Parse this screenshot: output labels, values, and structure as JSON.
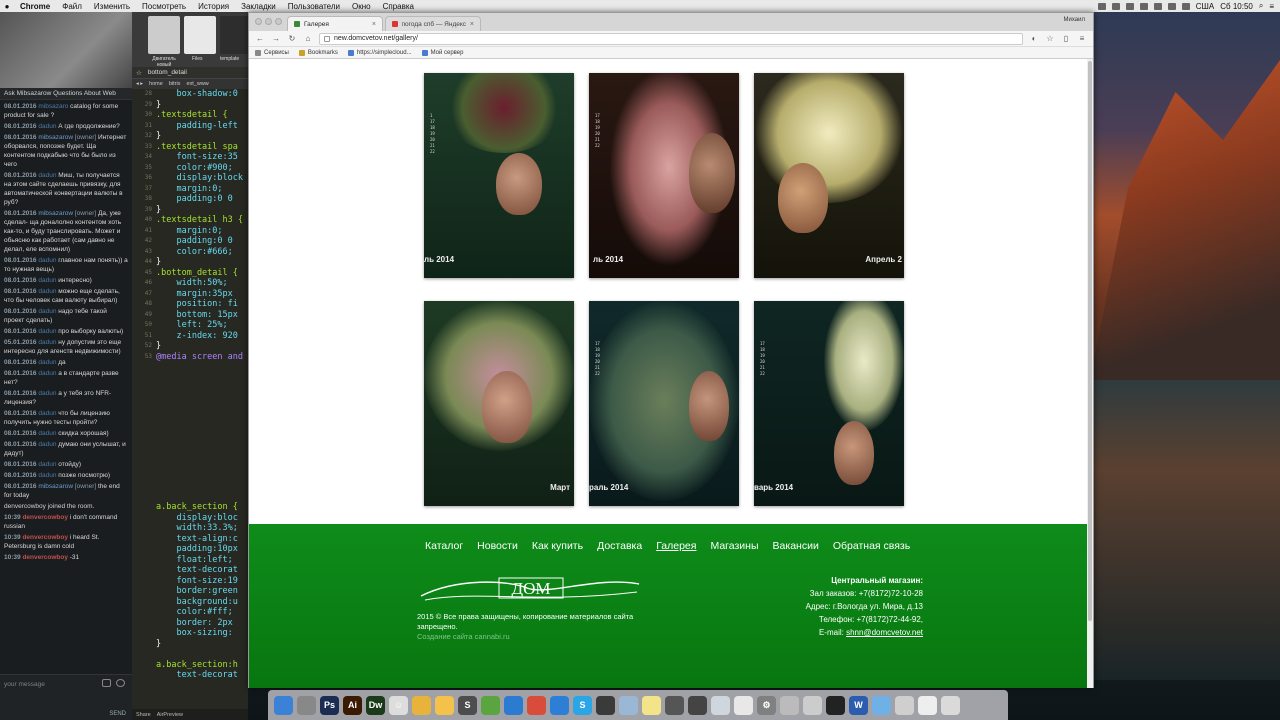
{
  "menubar": {
    "app": "Chrome",
    "items": [
      "Файл",
      "Изменить",
      "Посмотреть",
      "История",
      "Закладки",
      "Пользователи",
      "Окно",
      "Справка"
    ],
    "status_right": "США",
    "clock": "Сб 10:50"
  },
  "chat": {
    "title": "Ask Mibsazarow Questions About Web",
    "messages": [
      {
        "time": "08.01.2016",
        "user": "mibsazaro",
        "text": "catalog for some product for sale ?",
        "kind": "user"
      },
      {
        "time": "08.01.2016",
        "user": "dadun",
        "text": "А где продолжение?",
        "kind": "user"
      },
      {
        "time": "08.01.2016",
        "user": "mibsazarow",
        "tag": "[owner]",
        "text": "Интернет оборвался, попозже будет. Ща контентом подкабыю что бы было из чего",
        "kind": "owner"
      },
      {
        "time": "08.01.2016",
        "user": "dadun",
        "text": "Миш, ты получается на этом сайте сделаешь привязку, для автоматической конвертации валюты в руб?",
        "kind": "user"
      },
      {
        "time": "08.01.2016",
        "user": "mibsazarow",
        "tag": "[owner]",
        "text": "Да, уже сделал- ща доналолно контентом хоть как-то, и буду транслировать. Может и обьясню как работает (сам давно не делал, еле вспомнил)",
        "kind": "owner"
      },
      {
        "time": "08.01.2016",
        "user": "dadun",
        "text": "главное нам понять)) а то нужная вещь)",
        "kind": "user"
      },
      {
        "time": "08.01.2016",
        "user": "dadun",
        "text": "интересно)",
        "kind": "user"
      },
      {
        "time": "08.01.2016",
        "user": "dadun",
        "text": "можно еще сделать, что бы человек сам валюту выбирал)",
        "kind": "user"
      },
      {
        "time": "08.01.2016",
        "user": "dadun",
        "text": "надо тебе такой проект сделать)",
        "kind": "user"
      },
      {
        "time": "08.01.2016",
        "user": "dadun",
        "text": "про выборку валюты)",
        "kind": "user"
      },
      {
        "time": "05.01.2016",
        "user": "dadun",
        "text": "ну допустим это еще интересно для агенств недвижимости)",
        "kind": "user"
      },
      {
        "time": "08.01.2016",
        "user": "dadun",
        "text": "да",
        "kind": "user"
      },
      {
        "time": "08.01.2016",
        "user": "dadun",
        "text": "а в стандарте разве нет?",
        "kind": "user"
      },
      {
        "time": "08.01.2016",
        "user": "dadun",
        "text": "а у тебя это NFR-лицензия?",
        "kind": "user"
      },
      {
        "time": "08.01.2016",
        "user": "dadun",
        "text": "что бы лицензию получить нужно тесты пройти?",
        "kind": "user"
      },
      {
        "time": "08.01.2016",
        "user": "dadun",
        "text": "скидка хорошая)",
        "kind": "user"
      },
      {
        "time": "08.01.2016",
        "user": "dadun",
        "text": "думаю они услышат, и дадут)",
        "kind": "user"
      },
      {
        "time": "08.01.2016",
        "user": "dadun",
        "text": "отойду)",
        "kind": "user"
      },
      {
        "time": "08.01.2016",
        "user": "dadun",
        "text": "позже посмотрю)",
        "kind": "user"
      },
      {
        "time": "08.01.2016",
        "user": "mibsazarow",
        "tag": "[owner]",
        "text": "the end for today",
        "kind": "owner"
      },
      {
        "time": "",
        "user": "",
        "text": "denvercowboy joined the room.",
        "kind": "sys"
      },
      {
        "time": "10:39",
        "user": "denvercowboy",
        "text": "i don't command russian",
        "kind": "red"
      },
      {
        "time": "10:39",
        "user": "denvercowboy",
        "text": "i heard St. Petersburg is damn cold",
        "kind": "red"
      },
      {
        "time": "10:39",
        "user": "denvercowboy",
        "text": "-31",
        "kind": "red"
      }
    ],
    "input_placeholder": "your message",
    "send_label": "SEND"
  },
  "editor": {
    "tiles": [
      "Двигатель новый",
      "Files",
      "template"
    ],
    "filename": "bottom_detail",
    "crumbs": [
      "home",
      "bitrix",
      "ext_www"
    ],
    "line_numbers": [
      "28",
      "29",
      "30",
      "31",
      "32",
      "33",
      "34",
      "35",
      "36",
      "37",
      "38",
      "39",
      "40",
      "41",
      "42",
      "43",
      "44",
      "45",
      "46",
      "47",
      "48",
      "49",
      "50",
      "51",
      "52",
      "53"
    ],
    "lines": [
      "    box-shadow:0",
      "}",
      ".textsdetail {",
      "    padding-left",
      "}",
      ".textsdetail spa",
      "    font-size:35",
      "    color:#900;",
      "    display:block",
      "    margin:0;",
      "    padding:0 0",
      "}",
      ".textsdetail h3 {",
      "    margin:0;",
      "    padding:0 0",
      "    color:#666;",
      "}",
      ".bottom_detail {",
      "    width:50%;",
      "    margin:35px",
      "    position: fi",
      "    bottom: 15px",
      "    left: 25%;",
      "    z-index: 920",
      "}",
      "@media screen and"
    ],
    "lines2": [
      "a.back_section {",
      "    display:bloc",
      "    width:33.3%;",
      "    text-align:c",
      "    padding:10px",
      "    float:left;",
      "    text-decorat",
      "    font-size:19",
      "    border:green",
      "    background:u",
      "    color:#fff;",
      "    border: 2px",
      "    box-sizing:",
      "}",
      "",
      "a.back_section:h",
      "    text-decorat"
    ],
    "status": [
      "Share",
      "AirPreview"
    ]
  },
  "browser": {
    "tabs": [
      {
        "label": "Галерея",
        "active": true
      },
      {
        "label": "погода спб — Яндекс: на",
        "active": false
      }
    ],
    "profile": "Михаил",
    "url": "new.domcvetov.net/gallery/",
    "bookmarks": [
      "Сервисы",
      "Bookmarks",
      "https://simplecloud...",
      "Мой сервер"
    ]
  },
  "gallery": {
    "captions": [
      "ль 2014",
      "ль 2014",
      "Апрель 2",
      "Март",
      "раль 2014",
      "варь 2014"
    ]
  },
  "footer": {
    "nav": [
      {
        "label": "Каталог",
        "active": false
      },
      {
        "label": "Новости",
        "active": false
      },
      {
        "label": "Как купить",
        "active": false
      },
      {
        "label": "Доставка",
        "active": false
      },
      {
        "label": "Галерея",
        "active": true
      },
      {
        "label": "Магазины",
        "active": false
      },
      {
        "label": "Вакансии",
        "active": false
      },
      {
        "label": "Обратная связь",
        "active": false
      }
    ],
    "logo_text": "ДОМ",
    "copyright": "2015 © Все права защищены, копирование материалов сайта запрещено.",
    "credit": "Создание сайта cannabi.ru",
    "contacts": {
      "heading": "Центральный магазин:",
      "line1": "Зал заказов: +7(8172)72-10-28",
      "line2": "Адрес: г.Вологда ул. Мира, д.13",
      "line3": "Телефон: +7(8172)72-44-92,",
      "email_label": "E-mail: ",
      "email": "shnn@domcvetov.net"
    }
  },
  "dock": {
    "icons": [
      {
        "name": "finder-icon",
        "color": "#3b82d6",
        "glyph": ""
      },
      {
        "name": "launchpad-icon",
        "color": "#888888",
        "glyph": ""
      },
      {
        "name": "photoshop-icon",
        "color": "#1b2b52",
        "glyph": "Ps"
      },
      {
        "name": "illustrator-icon",
        "color": "#3a1a00",
        "glyph": "Ai"
      },
      {
        "name": "dreamweaver-icon",
        "color": "#1b3a1a",
        "glyph": "Dw"
      },
      {
        "name": "emoji-icon",
        "color": "#dddddd",
        "glyph": "☺"
      },
      {
        "name": "chrome-canary-icon",
        "color": "#e8b33b",
        "glyph": ""
      },
      {
        "name": "sketch-icon",
        "color": "#f4c24b",
        "glyph": ""
      },
      {
        "name": "sublime-icon",
        "color": "#4d4d4d",
        "glyph": "S"
      },
      {
        "name": "leaf-icon",
        "color": "#5aa53f",
        "glyph": ""
      },
      {
        "name": "safari-icon",
        "color": "#2b7bd1",
        "glyph": ""
      },
      {
        "name": "chrome-icon",
        "color": "#d94b3b",
        "glyph": ""
      },
      {
        "name": "appstore-icon",
        "color": "#2d7fd6",
        "glyph": ""
      },
      {
        "name": "skype-icon",
        "color": "#2aa5e6",
        "glyph": "S"
      },
      {
        "name": "obs-icon",
        "color": "#3a3a3a",
        "glyph": ""
      },
      {
        "name": "preview-icon",
        "color": "#9bb7d6",
        "glyph": ""
      },
      {
        "name": "notes-icon",
        "color": "#f3e48a",
        "glyph": ""
      },
      {
        "name": "camera-icon",
        "color": "#555555",
        "glyph": ""
      },
      {
        "name": "capture-icon",
        "color": "#444444",
        "glyph": ""
      },
      {
        "name": "cubes-icon",
        "color": "#cfd6dd",
        "glyph": ""
      },
      {
        "name": "textedit-icon",
        "color": "#e8e8e8",
        "glyph": ""
      },
      {
        "name": "settings-icon",
        "color": "#808080",
        "glyph": "⚙"
      },
      {
        "name": "tools-icon",
        "color": "#bbbbbb",
        "glyph": ""
      },
      {
        "name": "disk-icon",
        "color": "#cccccc",
        "glyph": ""
      },
      {
        "name": "terminal-icon",
        "color": "#222222",
        "glyph": ""
      },
      {
        "name": "word-icon",
        "color": "#2b5cb0",
        "glyph": "W"
      },
      {
        "name": "folder-icon",
        "color": "#6fb0e6",
        "glyph": ""
      },
      {
        "name": "downloads-icon",
        "color": "#cfcfcf",
        "glyph": ""
      },
      {
        "name": "screens-icon",
        "color": "#eeeeee",
        "glyph": ""
      },
      {
        "name": "trash-icon",
        "color": "#dadada",
        "glyph": ""
      }
    ]
  }
}
